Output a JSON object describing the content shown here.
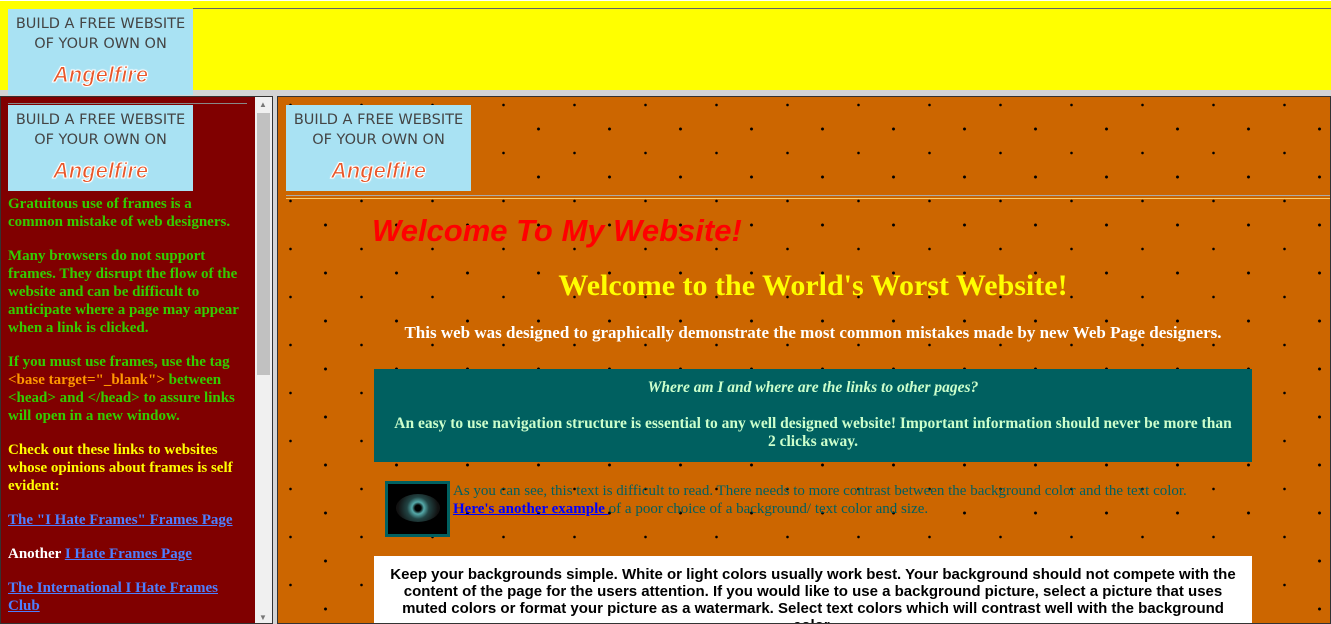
{
  "banner": {
    "line1": "BUILD A FREE WEBSITE",
    "line2": "OF YOUR OWN ON",
    "brand": "Angelfire"
  },
  "left": {
    "p1": "Gratuitous use of frames is a common mistake of web designers.",
    "p2": "Many browsers do not support frames. They disrupt the flow of the website and can be difficult to anticipate where a page may appear when a link is clicked.",
    "p3a": "If you must use frames, use the tag",
    "p3tag": "<base target=\"_blank\">",
    "p3b": "between <head> and </head> to assure links will open in a new window.",
    "p4": "Check out these links to websites whose opinions about frames is self evident:",
    "link1": "The \"I Hate Frames\" Frames Page",
    "another": "Another",
    "link2": "I Hate Frames Page",
    "link3": "The International I Hate Frames Club"
  },
  "main": {
    "welcome_red": "Welcome To My Website!",
    "welcome": "Welcome to the World's Worst Website!",
    "subtitle": "This web was designed to graphically demonstrate the most common mistakes made by new Web Page designers.",
    "nav_question": "Where am I and where are the links to other pages?",
    "nav_text": "An easy to use navigation structure is essential to any well designed website! Important information should never be more than 2 clicks away.",
    "contrast_text": "As you can see, this text is difficult to read. There needs to more contrast between the background color and the text color.",
    "example_link": "Here's another example ",
    "example_rest": "of a poor choice of a background/ text color and size.",
    "backgrounds_text": "Keep your backgrounds simple. White or light colors usually work best. Your background should not compete with the content of the page for the users attention. If you would like to use a background picture, select a picture that uses muted colors or format your picture as a watermark. Select text colors which will contrast well with the background color."
  },
  "colors": {
    "top_bg": "#ffff00",
    "left_bg": "#800000",
    "main_bg": "#cc6600",
    "teal": "#006060"
  }
}
